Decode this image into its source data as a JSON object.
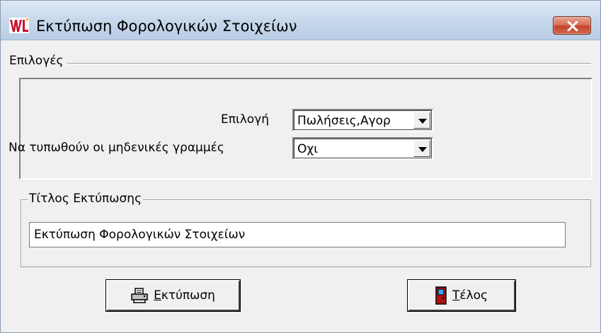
{
  "window": {
    "title": "Εκτύπωση Φορολογικών Στοιχείων",
    "app_icon": "wl-app-icon",
    "close_icon": "close-icon"
  },
  "options_group": {
    "legend": "Επιλογές",
    "selection": {
      "label": "Επιλογή",
      "value": "Πωλήσεις,Αγορ"
    },
    "print_zero_lines": {
      "label": "Να τυπωθούν οι μηδενικές γραμμές",
      "value": "Οχι"
    }
  },
  "title_group": {
    "legend": "Τίτλος Εκτύπωσης",
    "value": "Εκτύπωση Φορολογικών Στοιχείων"
  },
  "buttons": {
    "print": {
      "mnemonic": "Ε",
      "rest": "κτύπωση",
      "icon": "printer-icon"
    },
    "end": {
      "mnemonic": "Τ",
      "rest": "έλος",
      "icon": "exit-door-icon"
    }
  },
  "colors": {
    "titlebar": "#c9d9ec",
    "close_button": "#d2674b",
    "face": "#f0f0f0"
  }
}
